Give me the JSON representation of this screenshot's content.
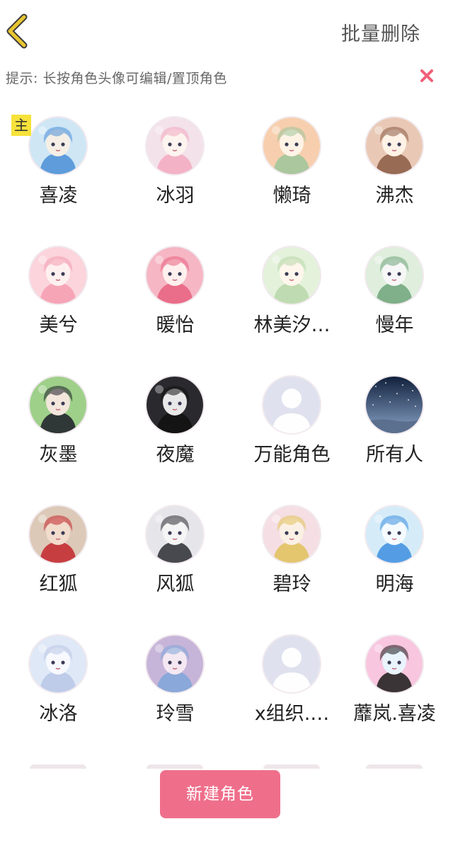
{
  "header": {
    "back_icon": "chevron-left-icon",
    "batch_delete_label": "批量删除",
    "accent_color": "#e8c531"
  },
  "hint": {
    "text": "提示: 长按角色头像可编辑/置顶角色",
    "close_icon": "close-icon",
    "close_color": "#f0607a"
  },
  "main_badge": "主",
  "roles": [
    {
      "name": "喜凌",
      "avatar": "anime-avatar",
      "palette": [
        "#cfe6f5",
        "#f5efe6",
        "#4a8ed6"
      ],
      "main": true
    },
    {
      "name": "冰羽",
      "avatar": "anime-avatar",
      "palette": [
        "#f3e2ea",
        "#fdf4ef",
        "#f3a9c0"
      ]
    },
    {
      "name": "懒琦",
      "avatar": "anime-avatar",
      "palette": [
        "#f7cfae",
        "#fff3e6",
        "#9dc59b"
      ]
    },
    {
      "name": "沸杰",
      "avatar": "anime-avatar",
      "palette": [
        "#e9c9b6",
        "#fff2e6",
        "#8a5a44"
      ]
    },
    {
      "name": "美兮",
      "avatar": "anime-avatar",
      "palette": [
        "#fbd4dc",
        "#fff0f0",
        "#f49cb0"
      ]
    },
    {
      "name": "暖怡",
      "avatar": "anime-avatar",
      "palette": [
        "#f6b6c4",
        "#fff0ee",
        "#e7607f"
      ]
    },
    {
      "name": "林美汐…",
      "avatar": "anime-avatar",
      "palette": [
        "#e4f2dc",
        "#fff6ec",
        "#b8d7a9"
      ]
    },
    {
      "name": "慢年",
      "avatar": "anime-avatar",
      "palette": [
        "#dfeedd",
        "#f7f7f7",
        "#6fa47a"
      ]
    },
    {
      "name": "灰墨",
      "avatar": "anime-avatar",
      "palette": [
        "#9fd08a",
        "#f3e6dc",
        "#1c1c28"
      ]
    },
    {
      "name": "夜魔",
      "avatar": "anime-avatar",
      "palette": [
        "#2a2a2e",
        "#e8e8e8",
        "#111111"
      ]
    },
    {
      "name": "万能角色",
      "avatar": "default-person-icon",
      "palette": [
        "#dfe2ee",
        "#ffffff",
        "#c4c9dc"
      ]
    },
    {
      "name": "所有人",
      "avatar": "night-sky-avatar",
      "palette": [
        "#10203c",
        "#8aa4c8",
        "#5b6f8e"
      ]
    },
    {
      "name": "红狐",
      "avatar": "anime-avatar",
      "palette": [
        "#ddc9b8",
        "#f2dccc",
        "#c3262b"
      ]
    },
    {
      "name": "风狐",
      "avatar": "anime-avatar",
      "palette": [
        "#e6e6ea",
        "#f5f5f5",
        "#2c2c34"
      ]
    },
    {
      "name": "碧玲",
      "avatar": "anime-avatar",
      "palette": [
        "#f5dfe4",
        "#fbf0e4",
        "#e1c25a"
      ]
    },
    {
      "name": "明海",
      "avatar": "anime-avatar",
      "palette": [
        "#d5ecf8",
        "#f5fbff",
        "#3d8fe0"
      ]
    },
    {
      "name": "冰洛",
      "avatar": "anime-avatar",
      "palette": [
        "#dfe8f7",
        "#f7f9ff",
        "#b9c7e6"
      ]
    },
    {
      "name": "玲雪",
      "avatar": "anime-avatar",
      "palette": [
        "#c7b5d9",
        "#f4e8f2",
        "#7fa6d8"
      ]
    },
    {
      "name": "x组织.…",
      "avatar": "default-person-icon",
      "palette": [
        "#dfe2ee",
        "#ffffff",
        "#c4c9dc"
      ]
    },
    {
      "name": "蘼岚.喜凌",
      "avatar": "anime-avatar",
      "palette": [
        "#f8c6df",
        "#e9f4ff",
        "#1a1a1a"
      ]
    }
  ],
  "footer": {
    "new_role_label": "新建角色",
    "button_color": "#ef6f8b"
  }
}
